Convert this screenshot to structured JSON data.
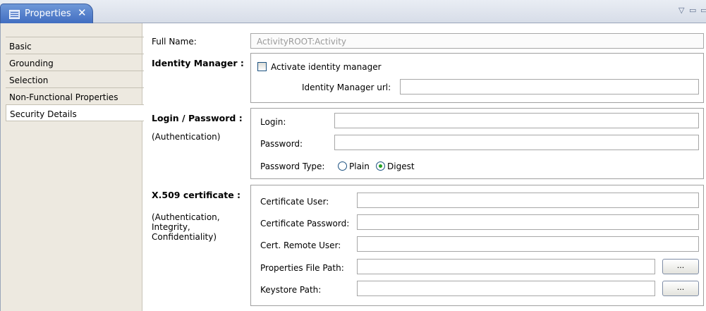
{
  "tab": {
    "label": "Properties"
  },
  "sidebar": {
    "items": [
      {
        "label": "Basic"
      },
      {
        "label": "Grounding"
      },
      {
        "label": "Selection"
      },
      {
        "label": "Non-Functional Properties"
      },
      {
        "label": "Security Details",
        "selected": true
      }
    ]
  },
  "form": {
    "full_name_label": "Full Name:",
    "full_name_value": "ActivityROOT:Activity",
    "identity": {
      "heading": "Identity Manager :",
      "checkbox_label": "Activate identity manager",
      "checked": false,
      "url_label": "Identity Manager url:",
      "url_value": ""
    },
    "login": {
      "heading": "Login / Password :",
      "subheading": "(Authentication)",
      "login_label": "Login:",
      "login_value": "",
      "password_label": "Password:",
      "password_value": "",
      "type_label": "Password Type:",
      "option_plain": "Plain",
      "option_digest": "Digest",
      "selected_type": "Digest"
    },
    "x509": {
      "heading": "X.509 certificate :",
      "subheading": "(Authentication,\nIntegrity,\nConfidentiality)",
      "cert_user_label": "Certificate User:",
      "cert_user_value": "",
      "cert_password_label": "Certificate Password:",
      "cert_password_value": "",
      "remote_user_label": "Cert. Remote User:",
      "remote_user_value": "",
      "props_path_label": "Properties File Path:",
      "props_path_value": "",
      "keystore_label": "Keystore Path:",
      "keystore_value": "",
      "browse_label": "..."
    }
  },
  "colors": {
    "tab_active": "#4a78c8",
    "sidebar_bg": "#ede9e0",
    "radio_dot": "#21a121"
  }
}
